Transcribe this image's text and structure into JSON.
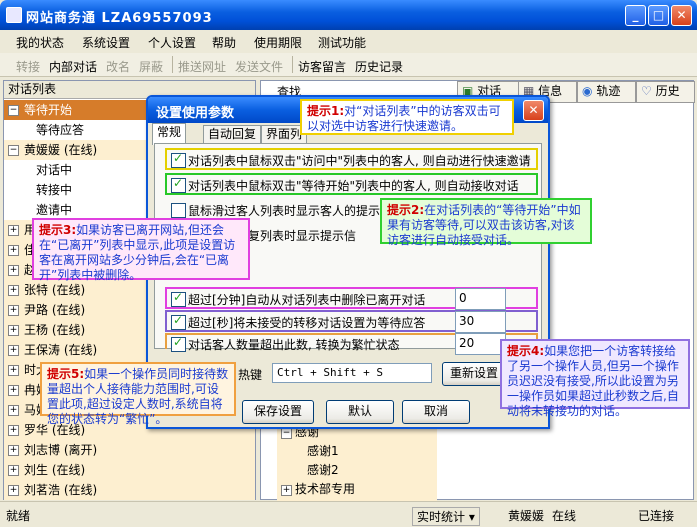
{
  "window": {
    "title": "网站商务通  LZA69557093",
    "min": "_",
    "max": "□",
    "close": "✕"
  },
  "menu": [
    "我的状态",
    "系统设置",
    "个人设置",
    "帮助",
    "使用期限",
    "测试功能"
  ],
  "toolbar": {
    "transfer": "转接",
    "internal": "内部对话",
    "rename": "改名",
    "block": "屏蔽",
    "push_url": "推送网址",
    "send_file": "发送文件",
    "leave_msg": "访客留言",
    "history": "历史记录"
  },
  "left": {
    "header": "对话列表",
    "rows": [
      {
        "text": "等待开始",
        "type": "sel",
        "pm": "−"
      },
      {
        "text": "等待应答",
        "type": "sub"
      },
      {
        "text": "黄媛媛 (在线)",
        "type": "grp",
        "pm": "−"
      },
      {
        "text": "对话中",
        "type": "sub"
      },
      {
        "text": "转接中",
        "type": "sub"
      },
      {
        "text": "邀请中",
        "type": "sub"
      },
      {
        "text": "用",
        "type": "grp",
        "pm": "+"
      },
      {
        "text": "佳",
        "type": "grp",
        "pm": "+"
      },
      {
        "text": "赵",
        "type": "grp",
        "pm": "+"
      },
      {
        "text": "张特 (在线)",
        "type": "grp",
        "pm": "+"
      },
      {
        "text": "尹路 (在线)",
        "type": "grp",
        "pm": "+"
      },
      {
        "text": "王杨 (在线)",
        "type": "grp",
        "pm": "+"
      },
      {
        "text": "王保涛 (在线)",
        "type": "grp",
        "pm": "+"
      },
      {
        "text": "时大",
        "type": "grp",
        "pm": "+"
      },
      {
        "text": "冉姐",
        "type": "grp",
        "pm": "+"
      },
      {
        "text": "马姐",
        "type": "grp",
        "pm": "+"
      },
      {
        "text": "罗华 (在线)",
        "type": "grp",
        "pm": "+"
      },
      {
        "text": "刘志博 (离开)",
        "type": "grp",
        "pm": "+"
      },
      {
        "text": "刘生 (在线)",
        "type": "grp",
        "pm": "+"
      },
      {
        "text": "刘茗浩 (在线)",
        "type": "grp",
        "pm": "+"
      }
    ]
  },
  "right": {
    "search_label": "查找",
    "tabs": [
      "对话",
      "信息",
      "轨迹",
      "历史"
    ],
    "tree": [
      {
        "text": "感谢",
        "level": 0,
        "pm": "−"
      },
      {
        "text": "感谢1",
        "level": 1
      },
      {
        "text": "感谢2",
        "level": 1
      },
      {
        "text": "技术部专用",
        "level": 0,
        "pm": "+"
      }
    ]
  },
  "dialog": {
    "title": "设置使用参数",
    "close": "✕",
    "tabs": [
      "常规",
      "自动回复",
      "界面列"
    ],
    "options": [
      {
        "label": "对话列表中鼠标双击\"访问中\"列表中的客人, 则自动进行快速邀请",
        "checked": true
      },
      {
        "label": "对话列表中鼠标双击\"等待开始\"列表中的客人, 则自动接收对话",
        "checked": true
      },
      {
        "label": "鼠标滑过客人列表时显示客人的提示",
        "checked": false
      },
      {
        "label": "鼠标滑过回复列表时显示提示信",
        "checked": false
      }
    ],
    "numeric": [
      {
        "label": "超过[分钟]自动从对话列表中删除已离开对话",
        "value": "0",
        "checked": true
      },
      {
        "label": "超过[秒]将未接受的转移对话设置为等待应答",
        "value": "30",
        "checked": true
      },
      {
        "label": "对话客人数量超出此数, 转换为繁忙状态",
        "value": "20",
        "checked": true
      }
    ],
    "hotkey_label": "热键",
    "hotkey_value": "Ctrl + Shift + S",
    "reset": "重新设置",
    "save": "保存设置",
    "ok": "默认",
    "cancel": "取消"
  },
  "tips": {
    "t1_title": "提示1:",
    "t1_text": "对“对话列表”中的访客双击可以对选中访客进行快速邀请。",
    "t2_title": "提示2:",
    "t2_text": "在对话列表的“等待开始”中如果有访客等待,可以双击该访客,对该访客进行自动接受对话。",
    "t3_title": "提示3:",
    "t3_text": "如果访客已离开网站,但还会在“已离开”列表中显示,此项是设置访客在离开网站多少分钟后,会在“已离开”列表中被删除。",
    "t4_title": "提示4:",
    "t4_text": "如果您把一个访客转接给了另一个操作人员,但另一个操作员迟迟没有接受,所以此设置为另一操作员如果超过此秒数之后,自动将未转接功的对话。",
    "t5_title": "提示5:",
    "t5_text": "如果一个操作员同时接待数量超出个人接待能力范围时,可设置此项,超过设定人数时,系统自将您的状态转为“繁忙”。"
  },
  "status": {
    "ready": "就绪",
    "stats": "实时统计",
    "user": "黄媛媛",
    "online": "在线",
    "connected": "已连接"
  }
}
